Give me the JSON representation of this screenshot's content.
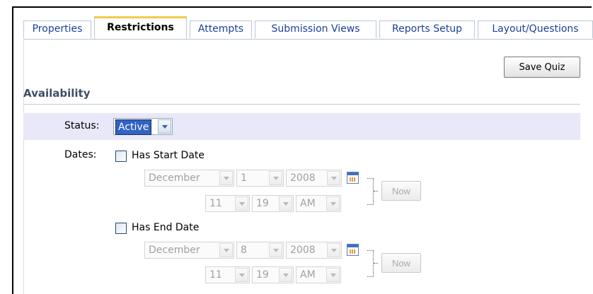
{
  "tabs": [
    {
      "label": "Properties",
      "active": false
    },
    {
      "label": "Restrictions",
      "active": true
    },
    {
      "label": "Attempts",
      "active": false
    },
    {
      "label": "Submission Views",
      "active": false
    },
    {
      "label": "Reports Setup",
      "active": false
    },
    {
      "label": "Layout/Questions",
      "active": false
    }
  ],
  "toolbar": {
    "save_label": "Save Quiz"
  },
  "availability": {
    "title": "Availability",
    "status": {
      "label": "Status:",
      "value": "Active"
    },
    "dates_label": "Dates:",
    "start": {
      "checkbox_label": "Has Start Date",
      "checked": false,
      "month": "December",
      "day": "1",
      "year": "2008",
      "hour": "11",
      "minute": "19",
      "ampm": "AM",
      "now_label": "Now"
    },
    "end": {
      "checkbox_label": "Has End Date",
      "checked": false,
      "month": "December",
      "day": "8",
      "year": "2008",
      "hour": "11",
      "minute": "19",
      "ampm": "AM",
      "now_label": "Now"
    }
  },
  "colors": {
    "tab_text": "#1a3f9e",
    "active_tab_accent": "#f2c94c",
    "highlight_row": "#e8e8f8",
    "selected_value_bg": "#3162c4"
  }
}
